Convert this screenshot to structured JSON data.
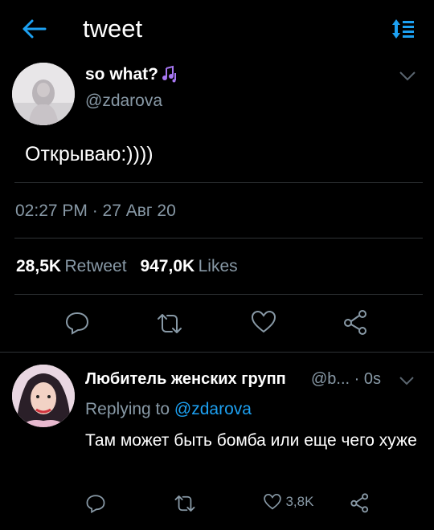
{
  "header": {
    "title": "tweet",
    "back_icon": "arrow-left-icon",
    "sort_icon": "sort-icon",
    "accent": "#1da1f2"
  },
  "tweet": {
    "author_name": "so what?",
    "author_handle": "@zdarova",
    "text": "Открываю:))))",
    "timestamp": "02:27 PM · 27 Авг 20",
    "retweets_count": "28,5K",
    "retweets_label": "Retweet",
    "likes_count": "947,0K",
    "likes_label": "Likes"
  },
  "reply": {
    "author_name": "Любитель женских групп",
    "meta": "@b... · 0s",
    "replying_prefix": "Replying to",
    "replying_handle": "@zdarova",
    "text": "Там может быть бомба или еще чего хуже",
    "likes_count": "3,8K"
  },
  "colors": {
    "background": "#000000",
    "text": "#ffffff",
    "muted": "#8899a6",
    "divider": "#2f3336",
    "link": "#1da1f2"
  }
}
